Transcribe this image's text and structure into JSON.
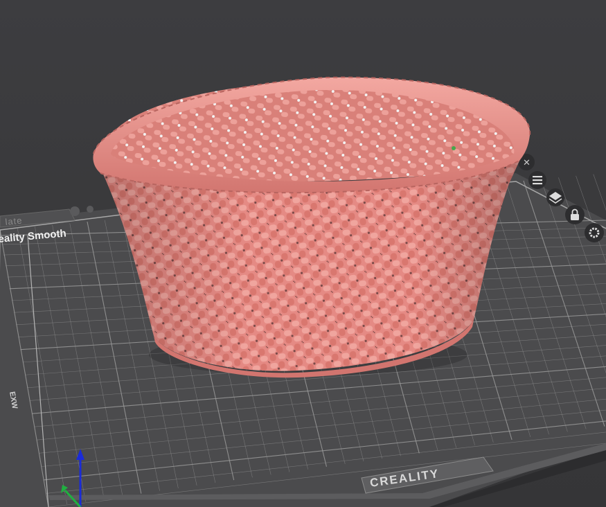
{
  "viewport": {
    "background": "#3a3a3c",
    "bed_color": "#4a4a4c",
    "grid_color": "#9a9a9a",
    "model_color": "#e58a84",
    "model_shadow": "#c86a66"
  },
  "plate": {
    "tab_label": "late",
    "bed_label": "eality Smooth",
    "brand_label": "CREALITY",
    "edge_label": "EXW"
  },
  "side_toolbar": {
    "buttons": [
      {
        "name": "close-icon"
      },
      {
        "name": "list-icon"
      },
      {
        "name": "layers-icon"
      },
      {
        "name": "lock-icon"
      },
      {
        "name": "gear-icon"
      }
    ]
  },
  "axes": {
    "z_color": "#1a2bd8",
    "y_color": "#20b040"
  }
}
